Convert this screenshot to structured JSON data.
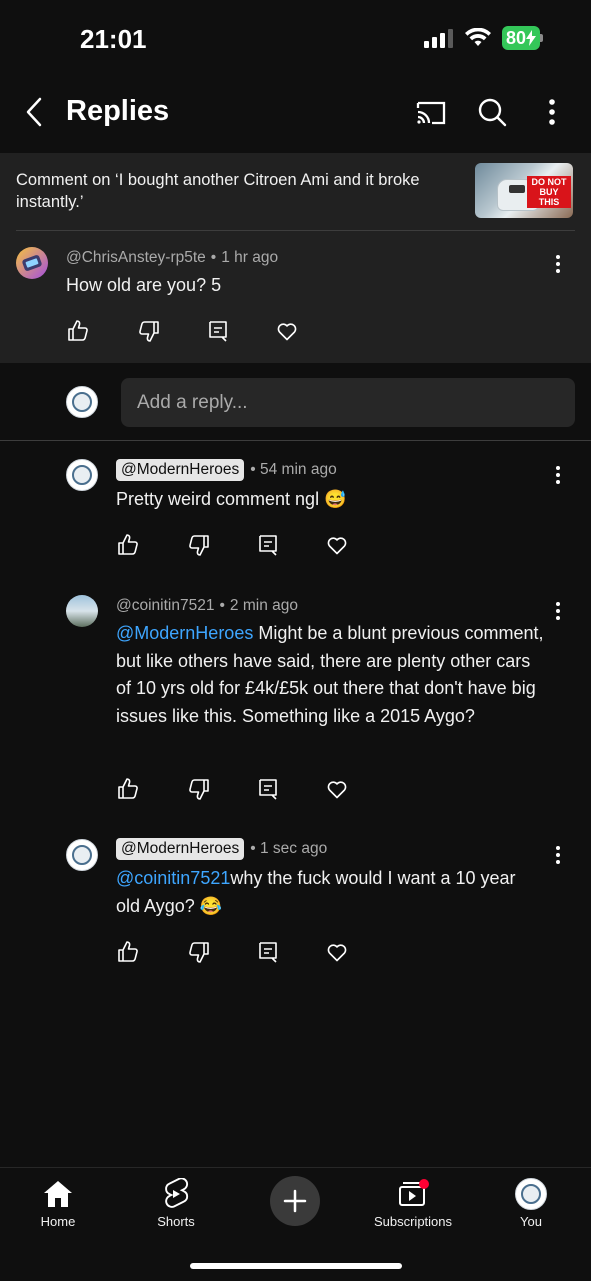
{
  "status_bar": {
    "time": "21:01",
    "battery": "80"
  },
  "header": {
    "title": "Replies"
  },
  "video_context": {
    "text": "Comment on ‘I bought another Citroen Ami and it broke instantly.’",
    "thumbnail_badge": "DO NOT BUY THIS"
  },
  "parent_comment": {
    "author": "@ChrisAnstey-rp5te",
    "time": "1 hr ago",
    "text": "How old are you? 5"
  },
  "reply_box": {
    "placeholder": "Add a reply..."
  },
  "replies": [
    {
      "author": "@ModernHeroes",
      "time": "54 min ago",
      "text": "Pretty weird comment ngl",
      "emoji": "😅"
    },
    {
      "author": "@coinitin7521",
      "time": "2 min ago",
      "mention": "@ModernHeroes",
      "text": " Might be a blunt previous comment, but like others have said, there are plenty other cars of 10 yrs old for £4k/£5k out there that don't have big issues like this. Something like a 2015 Aygo?"
    },
    {
      "author": "@ModernHeroes",
      "time": "1 sec ago",
      "mention": "@coinitin7521",
      "text": "why the fuck would I want a 10 year old Aygo?",
      "emoji": "😂"
    }
  ],
  "nav": {
    "home": "Home",
    "shorts": "Shorts",
    "subscriptions": "Subscriptions",
    "you": "You"
  },
  "colors": {
    "background": "#0f0f0f",
    "card": "#212121",
    "mention": "#3ea6ff",
    "battery": "#34c759"
  }
}
